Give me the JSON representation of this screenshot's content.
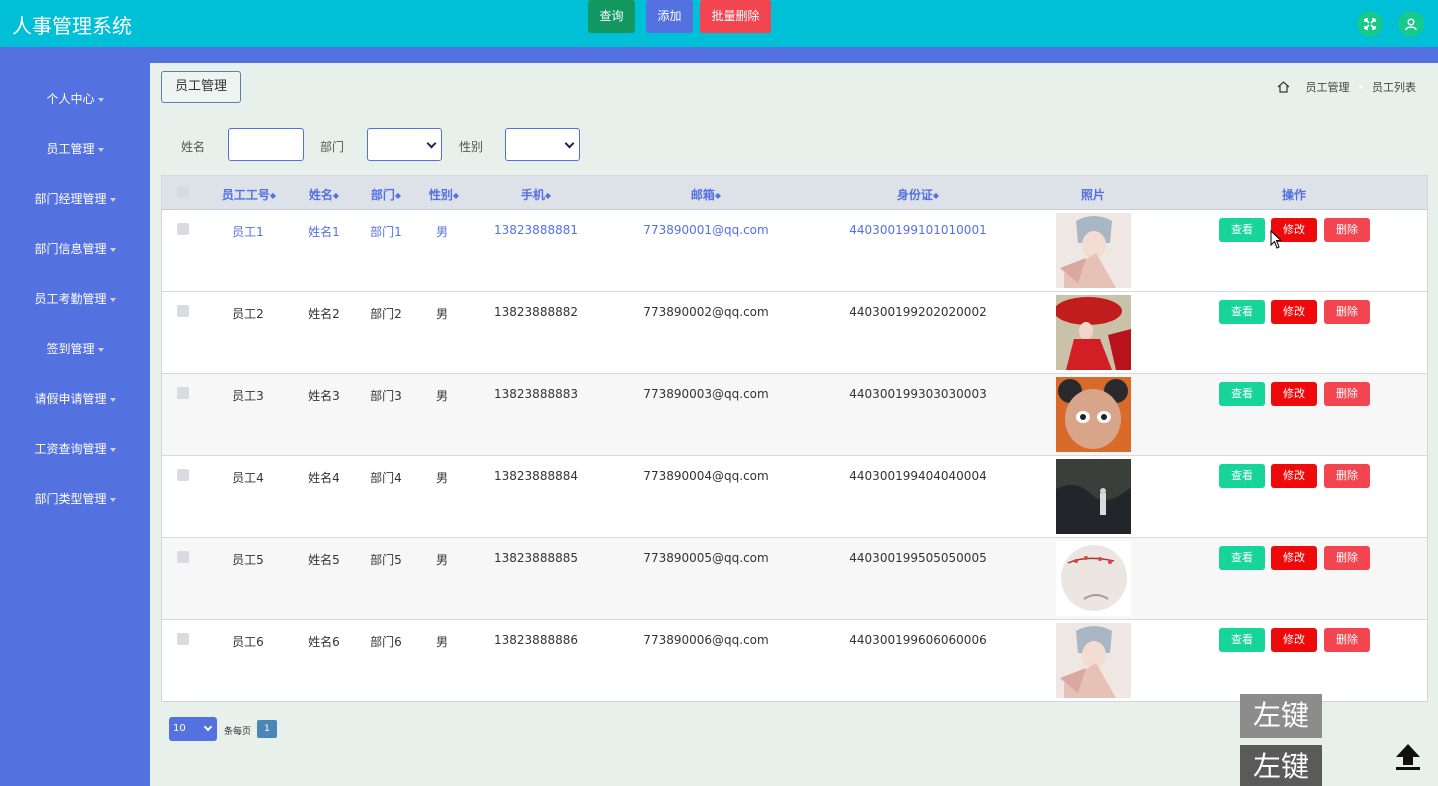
{
  "header": {
    "title": "人事管理系统",
    "fullscreen_icon": "fullscreen-icon",
    "user_icon": "user-icon"
  },
  "sidebar": {
    "items": [
      {
        "label": "个人中心"
      },
      {
        "label": "员工管理"
      },
      {
        "label": "部门经理管理"
      },
      {
        "label": "部门信息管理"
      },
      {
        "label": "员工考勤管理"
      },
      {
        "label": "签到管理"
      },
      {
        "label": "请假申请管理"
      },
      {
        "label": "工资查询管理"
      },
      {
        "label": "部门类型管理"
      }
    ]
  },
  "main": {
    "module_tag": "员工管理",
    "breadcrumb": [
      "员工管理",
      "员工列表"
    ],
    "search": {
      "name_label": "姓名",
      "name_value": "",
      "dept_label": "部门",
      "dept_value": "",
      "gender_label": "性别",
      "gender_value": "",
      "query_label": "查询",
      "add_label": "添加",
      "batch_delete_label": "批量删除"
    },
    "table": {
      "headers": [
        "员工工号",
        "姓名",
        "部门",
        "性别",
        "手机",
        "邮箱",
        "身份证",
        "照片",
        "操作"
      ],
      "rows": [
        {
          "id": "员工1",
          "name": "姓名1",
          "dept": "部门1",
          "gender": "男",
          "phone": "13823888881",
          "email": "773890001@qq.com",
          "idcard": "440300199101010001"
        },
        {
          "id": "员工2",
          "name": "姓名2",
          "dept": "部门2",
          "gender": "男",
          "phone": "13823888882",
          "email": "773890002@qq.com",
          "idcard": "440300199202020002"
        },
        {
          "id": "员工3",
          "name": "姓名3",
          "dept": "部门3",
          "gender": "男",
          "phone": "13823888883",
          "email": "773890003@qq.com",
          "idcard": "440300199303030003"
        },
        {
          "id": "员工4",
          "name": "姓名4",
          "dept": "部门4",
          "gender": "男",
          "phone": "13823888884",
          "email": "773890004@qq.com",
          "idcard": "440300199404040004"
        },
        {
          "id": "员工5",
          "name": "姓名5",
          "dept": "部门5",
          "gender": "男",
          "phone": "13823888885",
          "email": "773890005@qq.com",
          "idcard": "440300199505050005"
        },
        {
          "id": "员工6",
          "name": "姓名6",
          "dept": "部门6",
          "gender": "男",
          "phone": "13823888886",
          "email": "773890006@qq.com",
          "idcard": "440300199606060006"
        }
      ],
      "actions": {
        "view": "查看",
        "edit": "修改",
        "delete": "删除"
      }
    },
    "pagination": {
      "page_size": "10",
      "per_page_label": "条每页",
      "current_page": "1"
    }
  },
  "overlay": {
    "key_badge_1": "左键",
    "key_badge_2": "左键"
  },
  "colors": {
    "header": "#00c0d8",
    "sidebar": "#5471e0",
    "view": "#17d499",
    "edit": "#ee0a0a",
    "delete": "#f2454f"
  }
}
